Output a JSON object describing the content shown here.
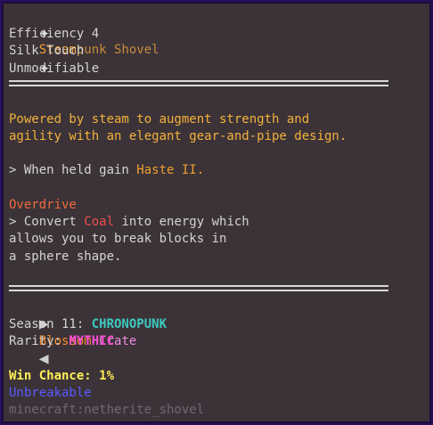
{
  "item": {
    "title_prefix": "Steam",
    "title_suffix": "punk Shovel",
    "star_left": "✦",
    "star_right": "✦",
    "enchant_1": "Efficiency 4",
    "enchant_2": "Silk Touch",
    "modifiable": "Unmodifiable"
  },
  "description": {
    "line_1": "Powered by steam to augment strength and",
    "line_2": "agility with an elegant gear-and-pipe design."
  },
  "held": {
    "arrow": "> ",
    "prefix": "When held gain ",
    "effect": "Haste II."
  },
  "ability": {
    "name": "Overdrive",
    "arrow": "> ",
    "prefix": "Convert ",
    "resource": "Coal",
    "suffix": " into energy which",
    "line_2": "allows you to break blocks in",
    "line_3": "a sphere shape."
  },
  "crate": {
    "name_part_1": "Blossom",
    "name_part_2": " Crate",
    "arrow_left": "▶",
    "arrow_right": "◀",
    "season_label": "Season 11: ",
    "season_value": "CHRONOPUNK",
    "rarity_label": "Rarity: ",
    "rarity_value": "MYTHIC",
    "win_chance_label": "Win Chance: ",
    "win_chance_value": "1%"
  },
  "footer": {
    "unbreakable": "Unbreakable",
    "item_id": "minecraft:netherite_shovel"
  },
  "colors": {
    "background": "#3b3338",
    "border": "#2b0f5e",
    "title": "#f0a030",
    "teal": "#3dc9c0",
    "magenta": "#ff4fd8",
    "blue": "#5b5bff",
    "red": "#f05050"
  }
}
